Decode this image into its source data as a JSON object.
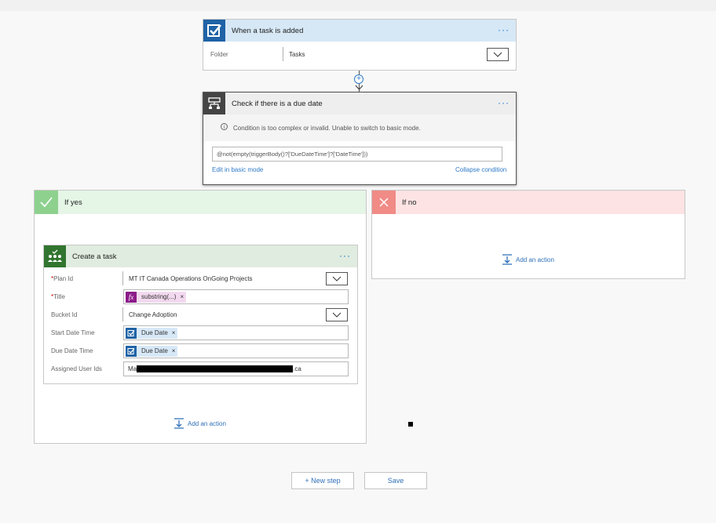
{
  "trigger": {
    "title": "When a task is added",
    "folder_label": "Folder",
    "folder_value": "Tasks"
  },
  "condition": {
    "title": "Check if there is a due date",
    "warning": "Condition is too complex or invalid. Unable to switch to basic mode.",
    "expression": "@not(empty(triggerBody()?['DueDateTime']?['DateTime']))",
    "edit_basic_link": "Edit in basic mode",
    "collapse_link": "Collapse condition"
  },
  "if_yes": {
    "title": "If yes",
    "add_action": "Add an action",
    "create_task": {
      "title": "Create a task",
      "fields": {
        "plan_id": {
          "label": "Plan Id",
          "value": "MT IT Canada Operations OnGoing Projects"
        },
        "title": {
          "label": "Title",
          "token": "substring(...)"
        },
        "bucket_id": {
          "label": "Bucket Id",
          "value": "Change Adoption"
        },
        "start_date": {
          "label": "Start Date Time",
          "token": "Due Date"
        },
        "due_date": {
          "label": "Due Date Time",
          "token": "Due Date"
        },
        "assigned": {
          "label": "Assigned User Ids",
          "prefix": "Ma",
          "suffix": ".ca"
        }
      }
    }
  },
  "if_no": {
    "title": "If no",
    "add_action": "Add an action"
  },
  "footer": {
    "new_step": "+ New step",
    "save": "Save"
  },
  "colors": {
    "accent": "#0a6ed1",
    "trigger_head": "#d6e8f6",
    "condition_head": "#eeeeee",
    "condition_icon": "#444444",
    "yes_head": "#e5f5e6",
    "yes_icon": "#8ed18f",
    "no_head": "#fde3e3",
    "no_icon": "#f08b86",
    "planner_head": "#e0ecdf",
    "planner_icon": "#31752f"
  }
}
